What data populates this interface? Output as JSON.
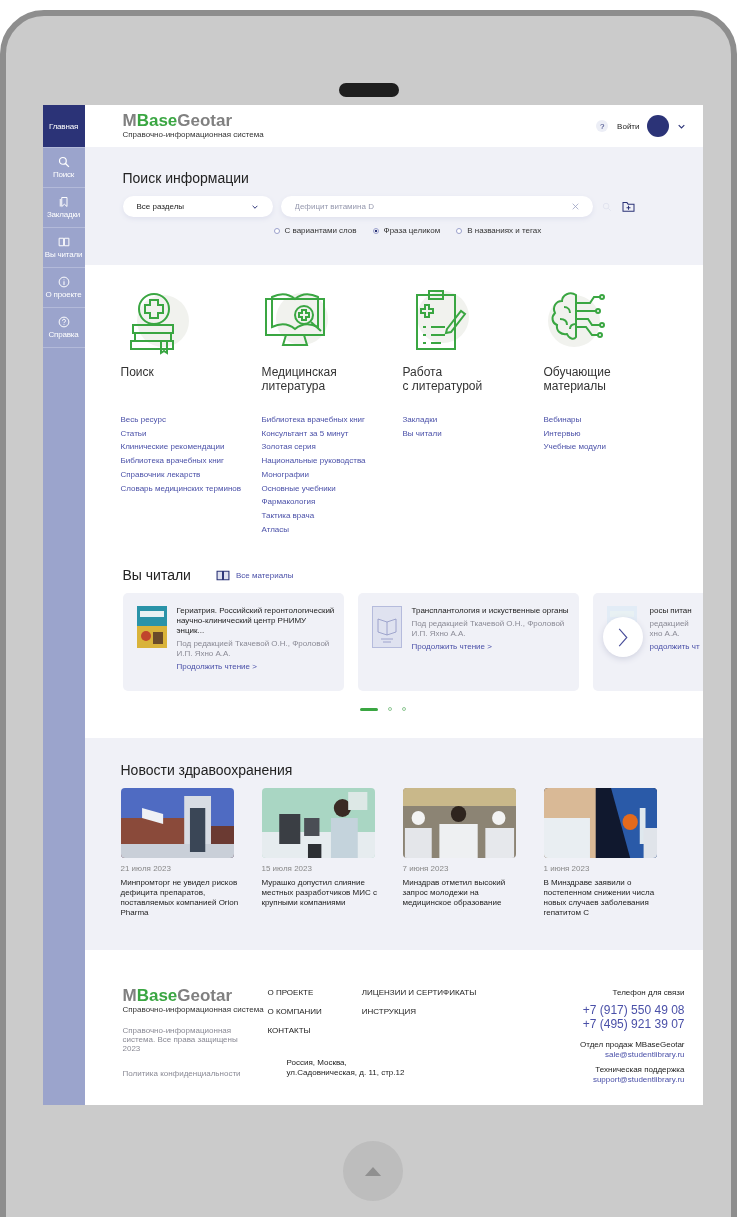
{
  "sidebar": {
    "items": [
      {
        "label": "Главная",
        "selected": true
      },
      {
        "label": "Поиск",
        "selected": false
      },
      {
        "label": "Закладки",
        "selected": false
      },
      {
        "label": "Вы читали",
        "selected": false
      },
      {
        "label": "О проекте",
        "selected": false
      },
      {
        "label": "Справка",
        "selected": false
      }
    ]
  },
  "header": {
    "logo": {
      "prefix": "M",
      "accent": "Base",
      "suffix": "Geotar",
      "tagline": "Справочно-информационная система"
    },
    "help": "?",
    "login": "Войти"
  },
  "search": {
    "title": "Поиск информации",
    "section_select": "Все разделы",
    "placeholder": "Дефицит витамина D",
    "modes": [
      {
        "label": "С вариантами слов",
        "selected": false
      },
      {
        "label": "Фраза целиком",
        "selected": true
      },
      {
        "label": "В названиях и тегах",
        "selected": false
      }
    ]
  },
  "categories": [
    {
      "title": "Поиск",
      "links": [
        "Весь ресурс",
        "Статьи",
        "Клинические рекомендации",
        "Библиотека врачебных книг",
        "Справочник лекарств",
        "Словарь медицинских терминов"
      ]
    },
    {
      "title": "Медицинская\nлитература",
      "links": [
        "Библиотека врачебных книг",
        "Консультант за 5 минут",
        "Золотая серия",
        "Национальные руководства",
        "Монографии",
        "Основные учебники",
        "Фармакология",
        "Тактика врача",
        "Атласы"
      ]
    },
    {
      "title": "Работа\nс литературой",
      "links": [
        "Закладки",
        "Вы читали"
      ]
    },
    {
      "title": "Обучающие\nматериалы",
      "links": [
        "Вебинары",
        "Интервью",
        "Учебные модули"
      ]
    }
  ],
  "reading": {
    "title": "Вы читали",
    "all_link": "Все материалы",
    "cards": [
      {
        "kind": "picture",
        "title": "Гериатрия. Российский геронтологический научно-клинический центр РНИМУ энцик...",
        "author": "Под редакцией Ткачевой О.Н., Фроловой И.П. Яхно А.А.",
        "link": "Продолжить чтение >"
      },
      {
        "kind": "placeholder",
        "title": "Трансплантология и искуственные органы",
        "author": "Под редакцией Ткачевой О.Н., Фроловой И.П. Яхно А.А.",
        "link": "Продолжить чтение >"
      },
      {
        "kind": "picture",
        "title": "росы питан",
        "author": "редакцией\nхно А.А.",
        "link": "родолжить чт"
      }
    ],
    "dots": [
      {
        "selected": true
      },
      {
        "selected": false
      },
      {
        "selected": false
      }
    ]
  },
  "news": {
    "title": "Новости здравоохранения",
    "items": [
      {
        "date": "21 июля 2023",
        "title": "Минпромторг не увидел рисков дефицита препаратов, поставляемых компанией Orion Pharma"
      },
      {
        "date": "15 июля 2023",
        "title": "Мурашко допустил слияние местных разработчиков МИС с крупными компаниями"
      },
      {
        "date": "7 июня 2023",
        "title": "Минздрав отметил высокий запрос молодежи на медицинское образование"
      },
      {
        "date": "1 июня 2023",
        "title": "В Минздраве заявили о постепенном снижении числа новых случаев заболевания гепатитом С"
      }
    ]
  },
  "footer": {
    "logo": {
      "prefix": "M",
      "accent": "Base",
      "suffix": "Geotar",
      "tagline": "Справочно-информационная система"
    },
    "copyright": "Справочно-информационная система. Все права защищены 2023",
    "privacy": "Политика конфиденциальности",
    "menu": [
      [
        "О ПРОЕКТЕ",
        "О КОМПАНИИ",
        "КОНТАКТЫ"
      ],
      [
        "ЛИЦЕНЗИИ И СЕРТИФИКАТЫ",
        "ИНСТРУКЦИЯ"
      ]
    ],
    "address": "Россия, Москва,\nул.Садовническая, д. 11, стр.12",
    "phone_label": "Телефон для связи",
    "phones": [
      "+7 (917) 550 49 08",
      "+7 (495) 921 39 07"
    ],
    "contacts": [
      {
        "label": "Отдел продаж MBaseGeotar",
        "email": "sale@studentlibrary.ru"
      },
      {
        "label": "Техническая поддержка",
        "email": "support@studentlibrary.ru"
      }
    ]
  }
}
